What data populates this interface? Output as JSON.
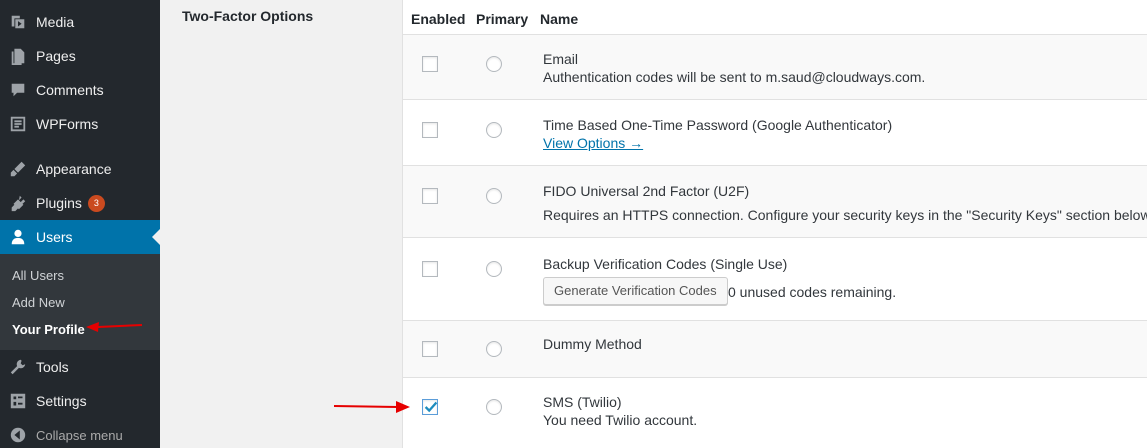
{
  "sidebar": {
    "menu": [
      {
        "label": "Media",
        "icon": "media-icon"
      },
      {
        "label": "Pages",
        "icon": "pages-icon"
      },
      {
        "label": "Comments",
        "icon": "comments-icon"
      },
      {
        "label": "WPForms",
        "icon": "wpforms-icon"
      },
      {
        "label": "Appearance",
        "icon": "appearance-icon"
      },
      {
        "label": "Plugins",
        "icon": "plugins-icon",
        "badge": "3"
      },
      {
        "label": "Users",
        "icon": "users-icon",
        "current": true
      },
      {
        "label": "Tools",
        "icon": "tools-icon"
      },
      {
        "label": "Settings",
        "icon": "settings-icon"
      }
    ],
    "submenu": [
      {
        "label": "All Users"
      },
      {
        "label": "Add New"
      },
      {
        "label": "Your Profile",
        "current": true
      }
    ],
    "collapse_label": "Collapse menu"
  },
  "field_label": "Two-Factor Options",
  "table": {
    "headers": {
      "enabled": "Enabled",
      "primary": "Primary",
      "name": "Name"
    },
    "methods": [
      {
        "name": "Email",
        "description": "Authentication codes will be sent to m.saud@cloudways.com.",
        "enabled": false
      },
      {
        "name": "Time Based One-Time Password (Google Authenticator)",
        "link": "View Options →",
        "enabled": false
      },
      {
        "name": "FIDO Universal 2nd Factor (U2F)",
        "description": "Requires an HTTPS connection. Configure your security keys in the \"Security Keys\" section below.",
        "enabled": false
      },
      {
        "name": "Backup Verification Codes (Single Use)",
        "button": "Generate Verification Codes",
        "after_button": "0 unused codes remaining.",
        "enabled": false
      },
      {
        "name": "Dummy Method",
        "enabled": false
      },
      {
        "name": "SMS (Twilio)",
        "description": "You need Twilio account.",
        "enabled": true
      }
    ]
  },
  "colors": {
    "sidebar_bg": "#23282d",
    "current_menu": "#0073aa",
    "link": "#0073aa",
    "badge": "#ca4a1f",
    "annotation_arrow": "#e60000"
  }
}
